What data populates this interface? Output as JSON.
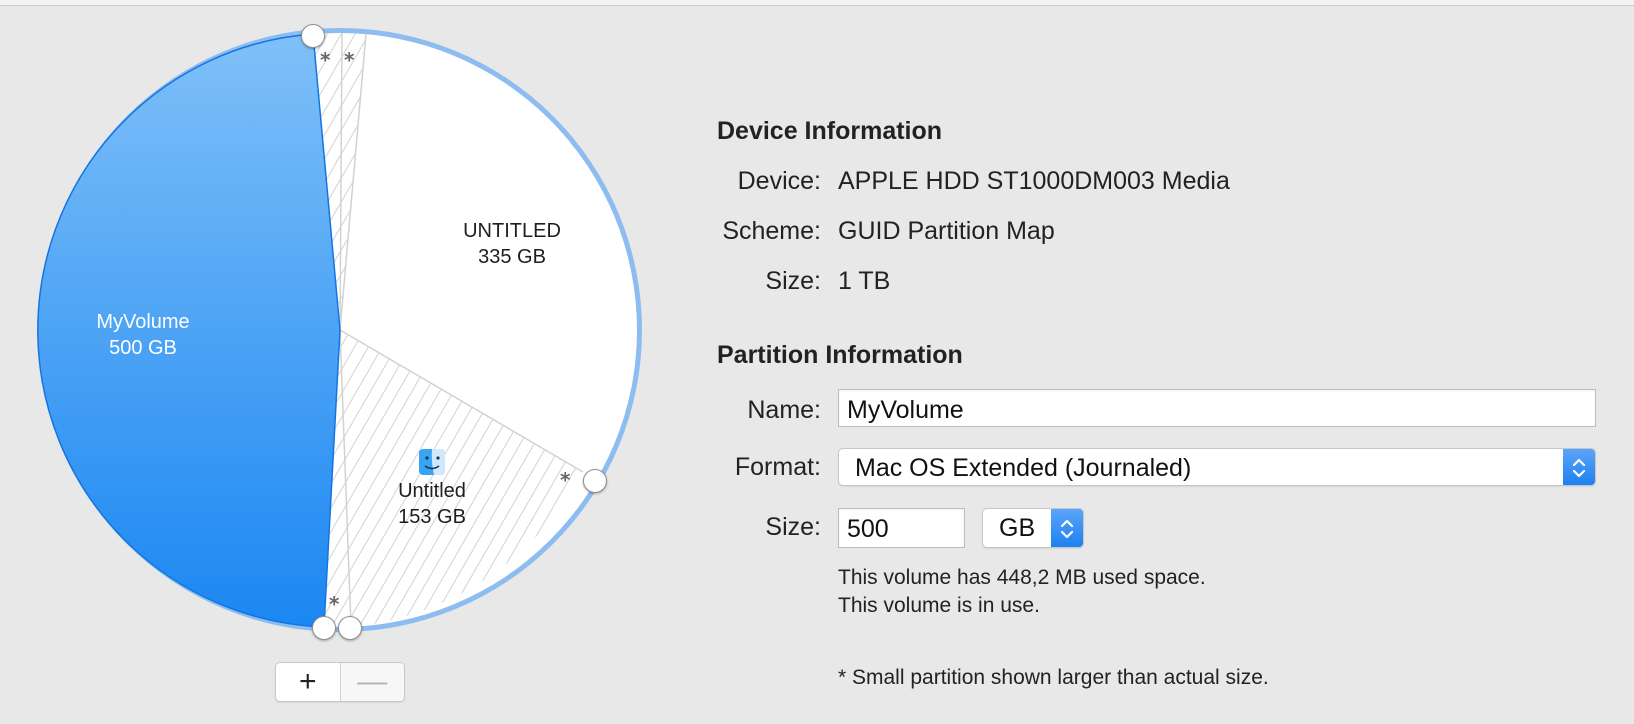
{
  "pie": {
    "volumes": [
      {
        "name": "MyVolume",
        "size": "500 GB"
      },
      {
        "name": "UNTITLED",
        "size": "335 GB"
      },
      {
        "name": "Untitled",
        "size": "153 GB"
      }
    ],
    "small_partition_marker": "*",
    "colors": {
      "accent": "#1a84f1",
      "ring": "#8cbcf0",
      "free": "#ffffff",
      "hatch": "#d6d6d6"
    }
  },
  "controls": {
    "add_label": "+",
    "remove_label": "—"
  },
  "device_info": {
    "title": "Device Information",
    "device_label": "Device:",
    "device_value": "APPLE HDD ST1000DM003 Media",
    "scheme_label": "Scheme:",
    "scheme_value": "GUID Partition Map",
    "size_label": "Size:",
    "size_value": "1 TB"
  },
  "partition_info": {
    "title": "Partition Information",
    "name_label": "Name:",
    "name_value": "MyVolume",
    "format_label": "Format:",
    "format_value": "Mac OS Extended (Journaled)",
    "size_label": "Size:",
    "size_value": "500",
    "size_unit": "GB",
    "used_note": "This volume has 448,2 MB used space.",
    "in_use_note": "This volume is in use.",
    "footnote": "* Small partition shown larger than actual size."
  }
}
